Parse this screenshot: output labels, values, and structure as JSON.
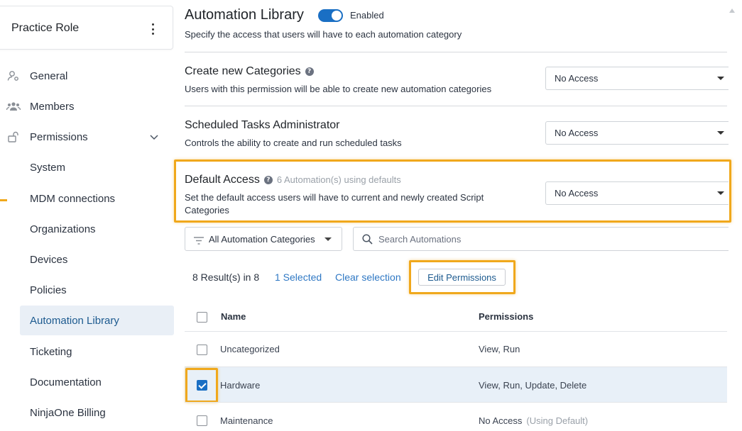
{
  "sidebar": {
    "role_title": "Practice Role",
    "items": [
      {
        "label": "General",
        "icon": "user-gear-icon"
      },
      {
        "label": "Members",
        "icon": "users-icon"
      },
      {
        "label": "Permissions",
        "icon": "unlock-icon"
      },
      {
        "label": "System"
      },
      {
        "label": "MDM connections"
      },
      {
        "label": "Organizations"
      },
      {
        "label": "Devices"
      },
      {
        "label": "Policies"
      },
      {
        "label": "Automation Library"
      },
      {
        "label": "Ticketing"
      },
      {
        "label": "Documentation"
      },
      {
        "label": "NinjaOne Billing"
      }
    ],
    "active": "Automation Library"
  },
  "header": {
    "title": "Automation Library",
    "toggle_label": "Enabled",
    "toggle_on": true,
    "subtitle": "Specify the access that users will have to each automation category"
  },
  "sections": {
    "create_categories": {
      "title": "Create new Categories",
      "description": "Users with this permission will be able to create new automation categories",
      "value": "No Access"
    },
    "scheduled_tasks": {
      "title": "Scheduled Tasks Administrator",
      "description": "Controls the ability to create and run scheduled tasks",
      "value": "No Access"
    },
    "default_access": {
      "title": "Default Access",
      "hint": "6 Automation(s) using defaults",
      "description_line1": "Set the default access users will have to current and newly created Script",
      "description_line2": "Categories",
      "value": "No Access"
    }
  },
  "toolbar": {
    "filter_label": "All Automation Categories",
    "search_placeholder": "Search Automations",
    "results_text": "8 Result(s) in 8",
    "selected_text": "1 Selected",
    "clear_text": "Clear selection",
    "edit_label": "Edit Permissions"
  },
  "table": {
    "headers": {
      "name": "Name",
      "permissions": "Permissions"
    },
    "rows": [
      {
        "name": "Uncategorized",
        "permissions": "View, Run",
        "note": "",
        "checked": false
      },
      {
        "name": "Hardware",
        "permissions": "View, Run, Update, Delete",
        "note": "",
        "checked": true
      },
      {
        "name": "Maintenance",
        "permissions": "No Access",
        "note": "(Using Default)",
        "checked": false
      }
    ]
  },
  "colors": {
    "accent": "#1a6fc4",
    "highlight": "#f0a81c",
    "active_nav_bg": "#e9eff6",
    "selected_row_bg": "#e8f0f8"
  }
}
